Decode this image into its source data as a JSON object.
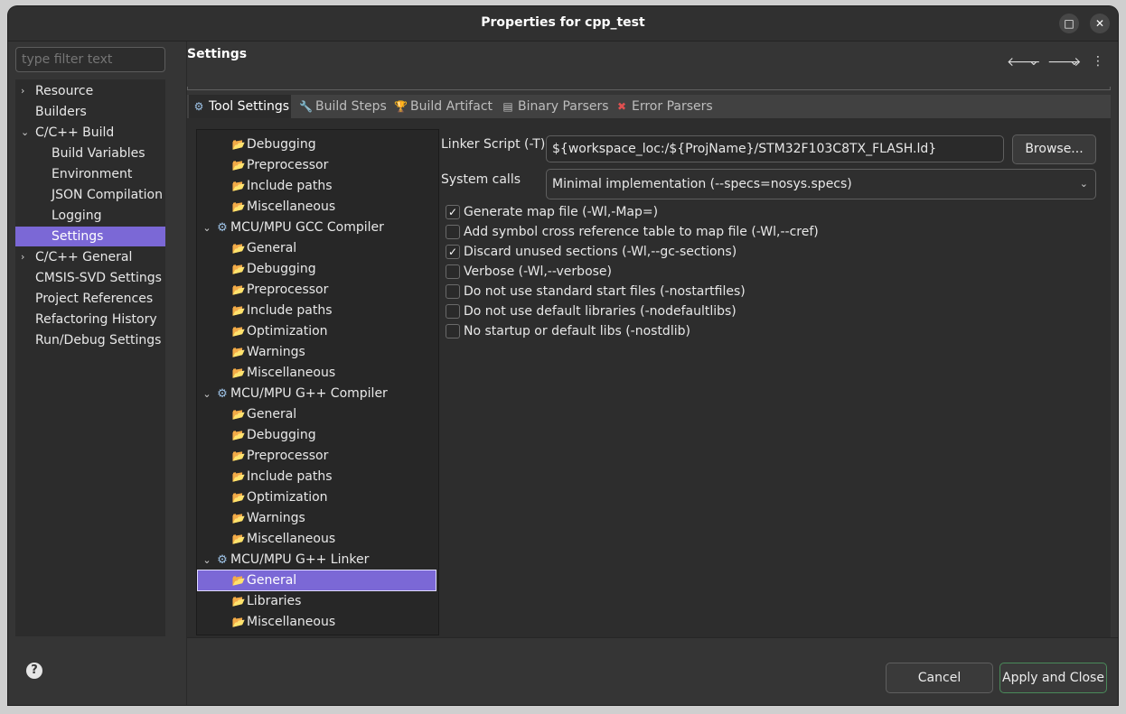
{
  "window": {
    "title": "Properties for cpp_test",
    "maximize_glyph": "□",
    "close_glyph": "✕"
  },
  "filter": {
    "placeholder": "type filter text"
  },
  "nav": {
    "items": [
      {
        "label": "Resource",
        "expander": "›"
      },
      {
        "label": "Builders"
      },
      {
        "label": "C/C++ Build",
        "expander": "⌄"
      },
      {
        "label": "Build Variables"
      },
      {
        "label": "Environment"
      },
      {
        "label": "JSON Compilation"
      },
      {
        "label": "Logging"
      },
      {
        "label": "Settings",
        "selected": true
      },
      {
        "label": "C/C++ General",
        "expander": "›"
      },
      {
        "label": "CMSIS-SVD Settings"
      },
      {
        "label": "Project References"
      },
      {
        "label": "Refactoring History"
      },
      {
        "label": "Run/Debug Settings"
      }
    ]
  },
  "help": {
    "glyph": "?"
  },
  "page": {
    "title": "Settings",
    "nav_back": "🡐",
    "nav_dropdown": "⌄",
    "nav_forward": "🡒",
    "menu": "⋮"
  },
  "tabs": [
    {
      "label": "Tool Settings",
      "icon": "gear-icon",
      "glyph": "⚙",
      "active": true
    },
    {
      "label": "Build Steps",
      "icon": "wrench-icon",
      "glyph": "🔧"
    },
    {
      "label": "Build Artifact",
      "icon": "trophy-icon",
      "glyph": "🏆"
    },
    {
      "label": "Binary Parsers",
      "icon": "binary-file-icon",
      "glyph": "▤"
    },
    {
      "label": "Error Parsers",
      "icon": "error-icon",
      "glyph": "✖"
    }
  ],
  "tool_tree": [
    {
      "label": "Debugging",
      "kind": "option"
    },
    {
      "label": "Preprocessor",
      "kind": "option"
    },
    {
      "label": "Include paths",
      "kind": "option"
    },
    {
      "label": "Miscellaneous",
      "kind": "option"
    },
    {
      "label": "MCU/MPU GCC Compiler",
      "kind": "tool"
    },
    {
      "label": "General",
      "kind": "option"
    },
    {
      "label": "Debugging",
      "kind": "option"
    },
    {
      "label": "Preprocessor",
      "kind": "option"
    },
    {
      "label": "Include paths",
      "kind": "option"
    },
    {
      "label": "Optimization",
      "kind": "option"
    },
    {
      "label": "Warnings",
      "kind": "option"
    },
    {
      "label": "Miscellaneous",
      "kind": "option"
    },
    {
      "label": "MCU/MPU G++ Compiler",
      "kind": "tool"
    },
    {
      "label": "General",
      "kind": "option"
    },
    {
      "label": "Debugging",
      "kind": "option"
    },
    {
      "label": "Preprocessor",
      "kind": "option"
    },
    {
      "label": "Include paths",
      "kind": "option"
    },
    {
      "label": "Optimization",
      "kind": "option"
    },
    {
      "label": "Warnings",
      "kind": "option"
    },
    {
      "label": "Miscellaneous",
      "kind": "option"
    },
    {
      "label": "MCU/MPU G++ Linker",
      "kind": "tool"
    },
    {
      "label": "General",
      "kind": "option",
      "selected": true
    },
    {
      "label": "Libraries",
      "kind": "option"
    },
    {
      "label": "Miscellaneous",
      "kind": "option"
    }
  ],
  "linker": {
    "script_label": "Linker Script (-T)",
    "script_value": "${workspace_loc:/${ProjName}/STM32F103C8TX_FLASH.ld}",
    "browse_label": "Browse...",
    "syscalls_label": "System calls",
    "syscalls_value": "Minimal implementation (--specs=nosys.specs)"
  },
  "options": [
    {
      "label": "Generate map file (-Wl,-Map=)",
      "checked": true
    },
    {
      "label": "Add symbol cross reference table to map file (-Wl,--cref)",
      "checked": false
    },
    {
      "label": "Discard unused sections (-Wl,--gc-sections)",
      "checked": true
    },
    {
      "label": "Verbose (-Wl,--verbose)",
      "checked": false
    },
    {
      "label": "Do not use standard start files (-nostartfiles)",
      "checked": false
    },
    {
      "label": "Do not use default libraries (-nodefaultlibs)",
      "checked": false
    },
    {
      "label": "No startup or default libs (-nostdlib)",
      "checked": false
    }
  ],
  "footer": {
    "cancel_label": "Cancel",
    "apply_close_label": "Apply and Close"
  },
  "colors": {
    "selection": "#7b68d6",
    "background": "#353535",
    "accent_border": "#4a8a5a"
  }
}
